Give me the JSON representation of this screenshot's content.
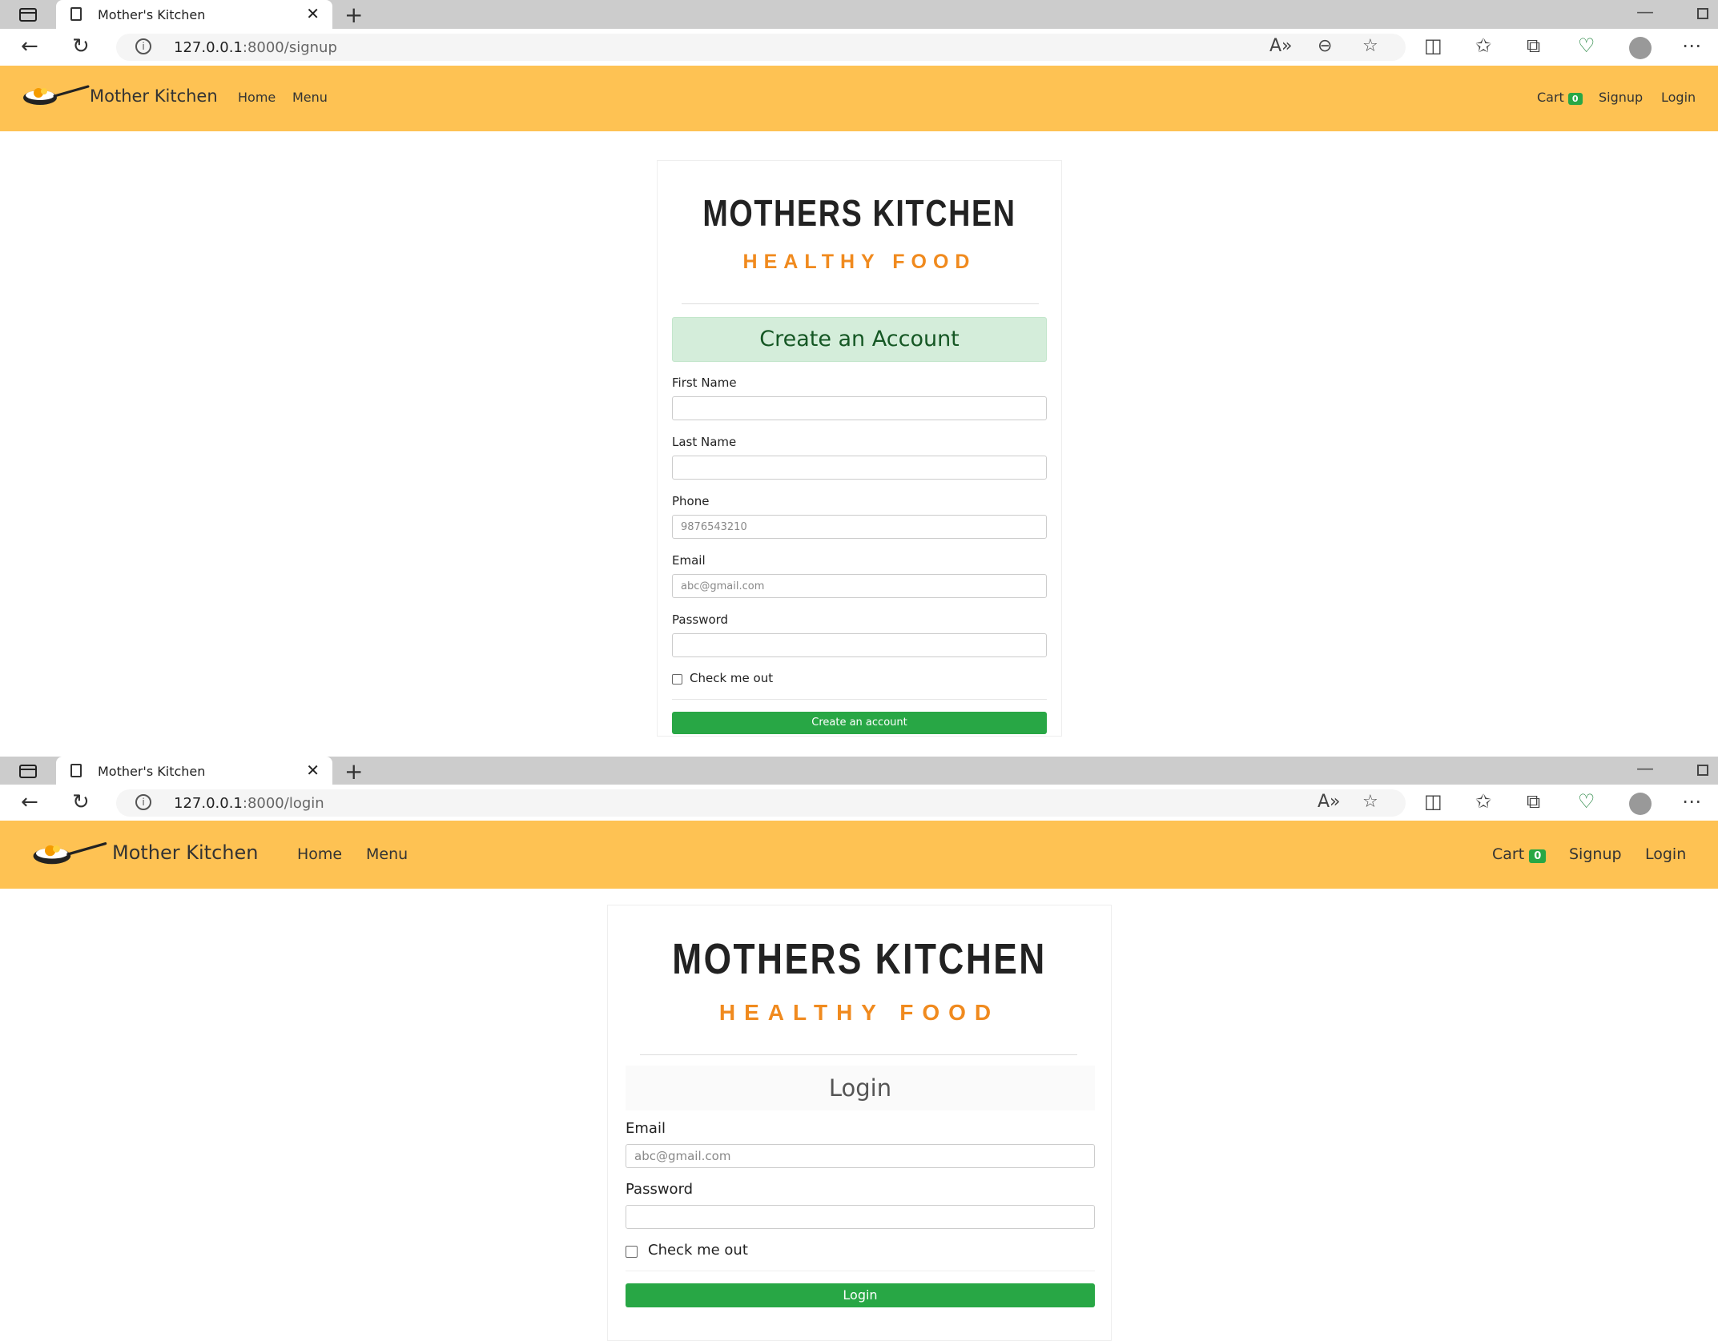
{
  "signup_window": {
    "tab_title": "Mother's Kitchen",
    "url_host": "127.0.0.1",
    "url_rest": ":8000/signup",
    "navbar": {
      "brand": "Mother Kitchen",
      "links": [
        "Home",
        "Menu"
      ],
      "cart_label": "Cart",
      "cart_count": "0",
      "signup_label": "Signup",
      "login_label": "Login"
    },
    "logo": {
      "title": "MOTHERS KITCHEN",
      "subtitle": "HEALTHY FOOD"
    },
    "form": {
      "heading": "Create an Account",
      "fields": [
        {
          "label": "First Name",
          "placeholder": ""
        },
        {
          "label": "Last Name",
          "placeholder": ""
        },
        {
          "label": "Phone",
          "placeholder": "9876543210"
        },
        {
          "label": "Email",
          "placeholder": "abc@gmail.com"
        },
        {
          "label": "Password",
          "placeholder": ""
        }
      ],
      "checkbox_label": "Check me out",
      "submit_label": "Create an account"
    }
  },
  "login_window": {
    "tab_title": "Mother's Kitchen",
    "url_host": "127.0.0.1",
    "url_rest": ":8000/login",
    "navbar": {
      "brand": "Mother Kitchen",
      "links": [
        "Home",
        "Menu"
      ],
      "cart_label": "Cart",
      "cart_count": "0",
      "signup_label": "Signup",
      "login_label": "Login"
    },
    "logo": {
      "title": "MOTHERS KITCHEN",
      "subtitle": "HEALTHY FOOD"
    },
    "form": {
      "heading": "Login",
      "fields": [
        {
          "label": "Email",
          "placeholder": "abc@gmail.com"
        },
        {
          "label": "Password",
          "placeholder": ""
        }
      ],
      "checkbox_label": "Check me out",
      "submit_label": "Login"
    }
  },
  "colors": {
    "navbar_bg": "#fec253",
    "accent_green": "#28a745",
    "heading_bg": "#d4edda",
    "heading_text": "#155724",
    "subtitle_orange": "#f08a1e"
  },
  "icons": [
    "sidebar-toggle-icon",
    "page-icon",
    "close-icon",
    "plus-icon",
    "back-icon",
    "refresh-icon",
    "info-icon",
    "read-aloud-icon",
    "zoom-icon",
    "favorite-star-icon",
    "split-screen-icon",
    "favorites-icon",
    "collections-icon",
    "browser-essentials-icon",
    "profile-icon",
    "more-icon",
    "pan-logo-icon"
  ]
}
